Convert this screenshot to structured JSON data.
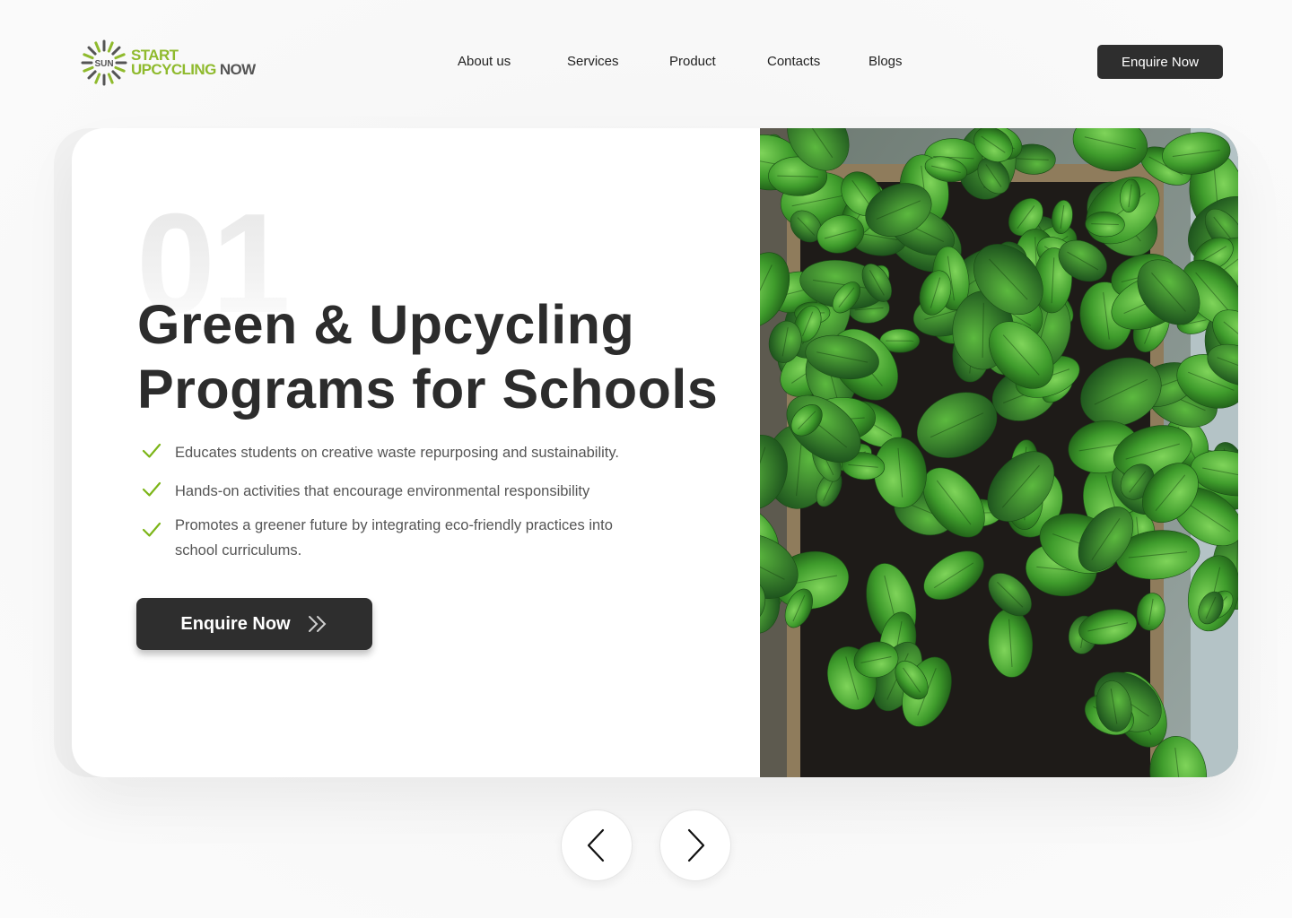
{
  "brand": {
    "badge": "SUN",
    "line1": "START",
    "line2_part1": "UPCYCLING",
    "line2_part2": "NOW"
  },
  "nav": {
    "items": [
      {
        "label": "About us"
      },
      {
        "label": "Services"
      },
      {
        "label": "Product"
      },
      {
        "label": "Contacts"
      },
      {
        "label": "Blogs"
      }
    ],
    "cta_label": "Enquire Now"
  },
  "hero": {
    "slide_number": "01",
    "title": "Green & Upcycling Programs for Schools",
    "features": [
      {
        "text": "Educates students on creative waste repurposing and sustainability.",
        "icon": "check-icon"
      },
      {
        "text": "Hands-on activities that encourage environmental responsibility",
        "icon": "check-icon"
      },
      {
        "text": "Promotes a greener future by integrating eco-friendly practices into school curriculums.",
        "icon": "check-icon"
      }
    ],
    "cta_label": "Enquire Now",
    "cta_icon": "double-chevron-right-icon",
    "image_subject": "basil-plants-photo"
  },
  "pager": {
    "prev_icon": "chevron-left-icon",
    "next_icon": "chevron-right-icon"
  },
  "colors": {
    "accent_green": "#8fba2d",
    "dark_button": "#2e2e2e",
    "check_green": "#7cb518"
  }
}
